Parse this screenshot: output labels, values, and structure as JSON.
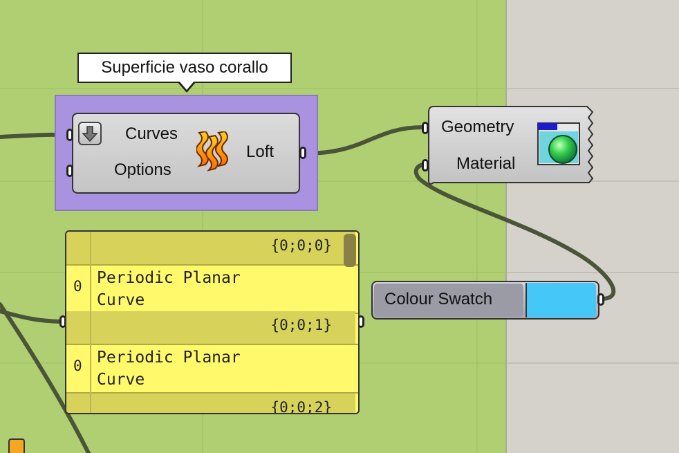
{
  "tooltip": {
    "text": "Superficie vaso corallo"
  },
  "loft": {
    "inputs": [
      "Curves",
      "Options"
    ],
    "output": "Loft"
  },
  "material": {
    "inputs": [
      "Geometry",
      "Material"
    ]
  },
  "panel": {
    "rows": [
      {
        "path": "{0;0;0}",
        "index": "0",
        "value": "Periodic Planar Curve"
      },
      {
        "path": "{0;0;1}",
        "index": "0",
        "value": "Periodic Planar Curve"
      },
      {
        "path": "{0;0;2}"
      }
    ]
  },
  "swatch": {
    "label": "Colour Swatch",
    "color": "#45c8f7"
  },
  "colors": {
    "canvas": "#b0cf72",
    "group": "#a993e0",
    "panel": "#fff96b",
    "wire": "#4a5438"
  }
}
